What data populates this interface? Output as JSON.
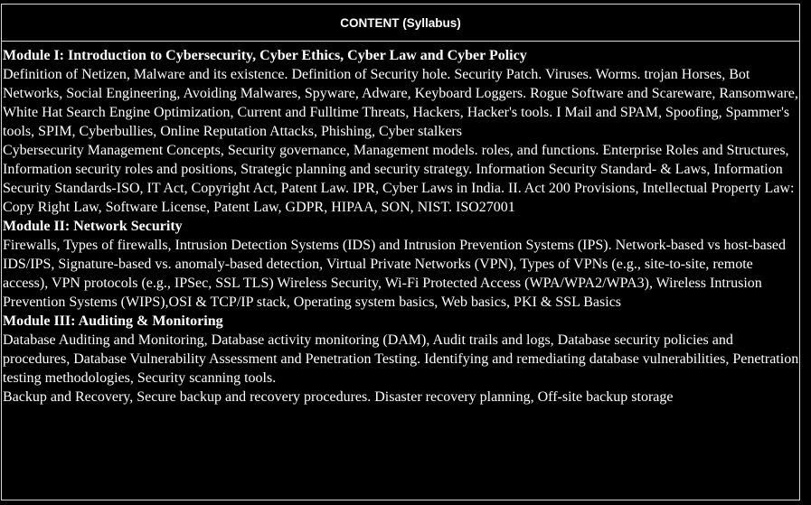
{
  "header": {
    "title": "CONTENT (Syllabus)"
  },
  "modules": [
    {
      "heading": "Module I: Introduction to Cybersecurity, Cyber Ethics, Cyber Law and Cyber Policy",
      "paragraphs": [
        "Definition of Netizen, Malware and its existence. Definition of Security hole. Security Patch. Viruses. Worms. trojan Horses, Bot Networks, Social Engineering, Avoiding Malwares, Spyware, Adware, Keyboard Loggers. Rogue Software and Scareware, Ransomware, White Hat Search Engine Optimization, Current and Fulltime Threats, Hackers, Hacker's tools. I Mail and SPAM, Spoofing, Spammer's tools, SPIM, Cyberbullies, Online Reputation Attacks, Phishing, Cyber stalkers",
        "Cybersecurity Management Concepts, Security governance, Management models. roles, and functions. Enterprise Roles and Structures, Information security roles and positions, Strategic planning and security strategy. Information Security Standard- & Laws, Information Security Standards-ISO, IT Act, Copyright Act, Patent Law. IPR, Cyber Laws in India. II. Act 200 Provisions, Intellectual Property Law: Copy Right Law, Software License, Patent Law, GDPR, HIPAA, SON, NIST. ISO27001"
      ]
    },
    {
      "heading": "Module II: Network Security",
      "paragraphs": [
        "Firewalls, Types of firewalls, Intrusion Detection Systems (IDS) and Intrusion Prevention Systems (IPS). Network-based vs host-based IDS/IPS, Signature-based vs. anomaly-based detection, Virtual Private Networks (VPN), Types of VPNs (e.g., site-to-site, remote access), VPN protocols (e.g., IPSec, SSL TLS) Wireless Security, Wi-Fi Protected Access (WPA/WPA2/WPA3), Wireless Intrusion Prevention Systems (WIPS),OSI & TCP/IP stack, Operating system basics, Web basics, PKI & SSL Basics"
      ]
    },
    {
      "heading": "Module III: Auditing & Monitoring",
      "paragraphs": [
        "Database Auditing and Monitoring, Database activity monitoring (DAM), Audit trails and logs, Database security policies and procedures, Database Vulnerability Assessment and Penetration Testing. Identifying and remediating database vulnerabilities, Penetration testing methodologies, Security scanning tools.",
        "Backup and Recovery, Secure backup and recovery procedures. Disaster recovery planning, Off-site backup storage"
      ]
    }
  ]
}
